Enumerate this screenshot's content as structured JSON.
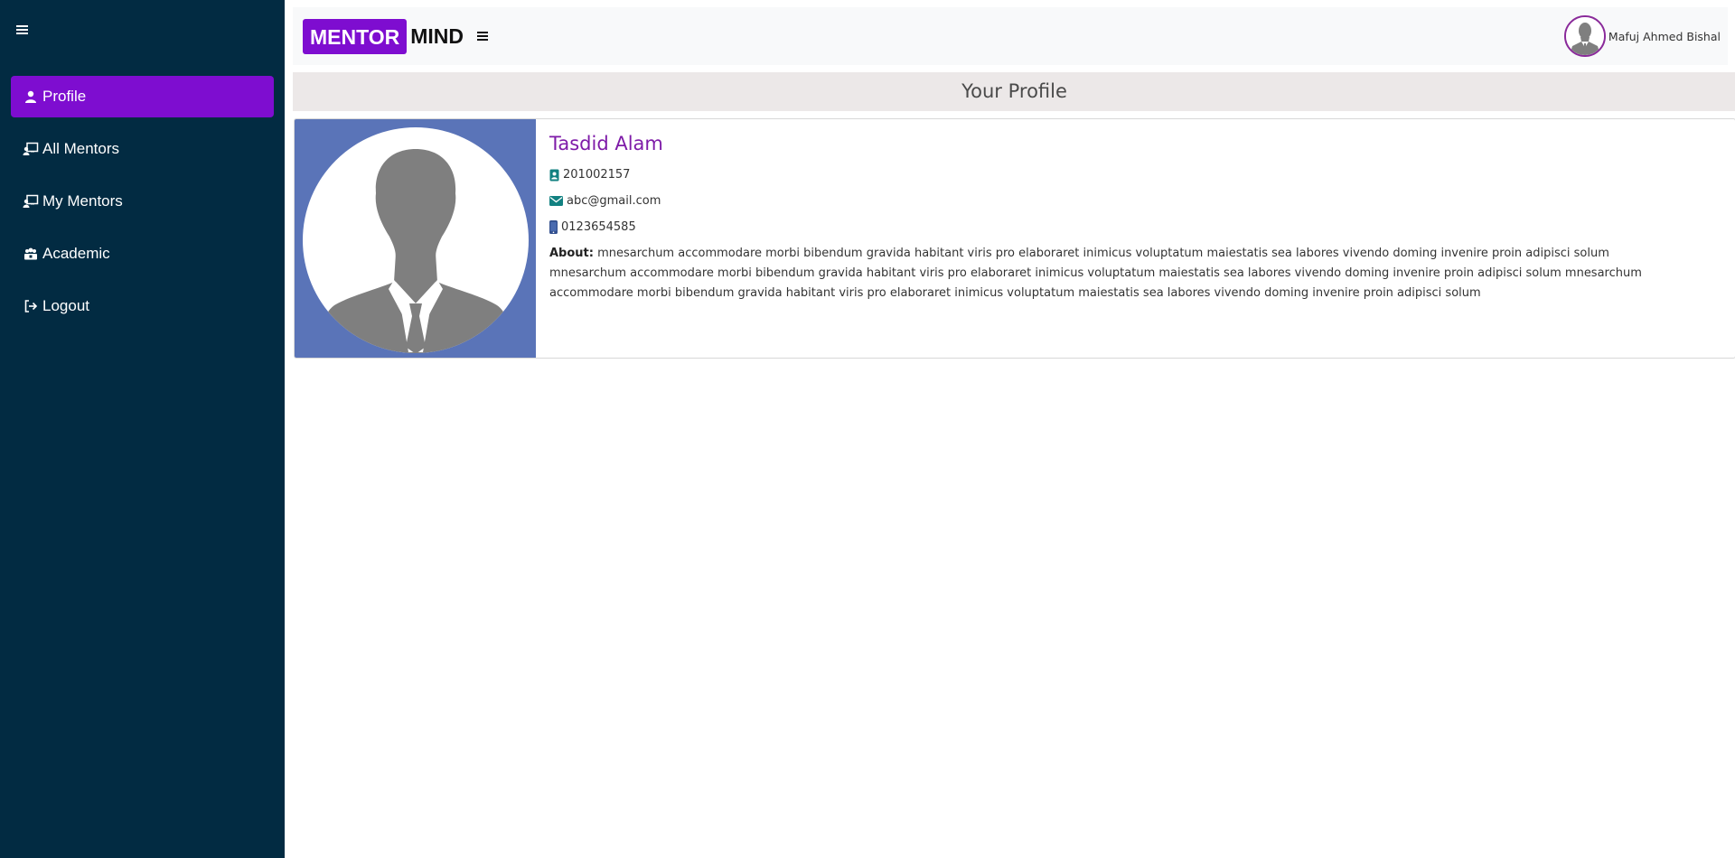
{
  "colors": {
    "sidebar_bg": "#022b42",
    "accent": "#7e0dd0",
    "name_color": "#7e1ba8",
    "icon_teal": "#128181",
    "photo_bg": "#5a74b8"
  },
  "sidebar": {
    "toggle_icon": "hamburger-icon",
    "items": [
      {
        "label": "Profile",
        "icon": "user-icon",
        "active": true
      },
      {
        "label": "All Mentors",
        "icon": "chalkboard-teacher-icon",
        "active": false
      },
      {
        "label": "My Mentors",
        "icon": "chalkboard-teacher-icon",
        "active": false
      },
      {
        "label": "Academic",
        "icon": "group-icon",
        "active": false
      },
      {
        "label": "Logout",
        "icon": "logout-icon",
        "active": false
      }
    ]
  },
  "header": {
    "brand_part1": "MENTOR",
    "brand_part2": "MIND",
    "toggle_icon": "hamburger-icon",
    "user_name": "Mafuj Ahmed Bishal",
    "user_avatar_icon": "person-avatar-icon"
  },
  "page": {
    "title": "Your Profile"
  },
  "profile": {
    "photo_icon": "person-silhouette-icon",
    "name": "Tasdid Alam",
    "student_id": "201002157",
    "email": "abc@gmail.com",
    "phone": "0123654585",
    "about_label": "About:",
    "about_text": "mnesarchum accommodare morbi bibendum gravida habitant viris pro elaboraret inimicus voluptatum maiestatis sea labores vivendo doming invenire proin adipisci solum mnesarchum accommodare morbi bibendum gravida habitant viris pro elaboraret inimicus voluptatum maiestatis sea labores vivendo doming invenire proin adipisci solum mnesarchum accommodare morbi bibendum gravida habitant viris pro elaboraret inimicus voluptatum maiestatis sea labores vivendo doming invenire proin adipisci solum"
  }
}
